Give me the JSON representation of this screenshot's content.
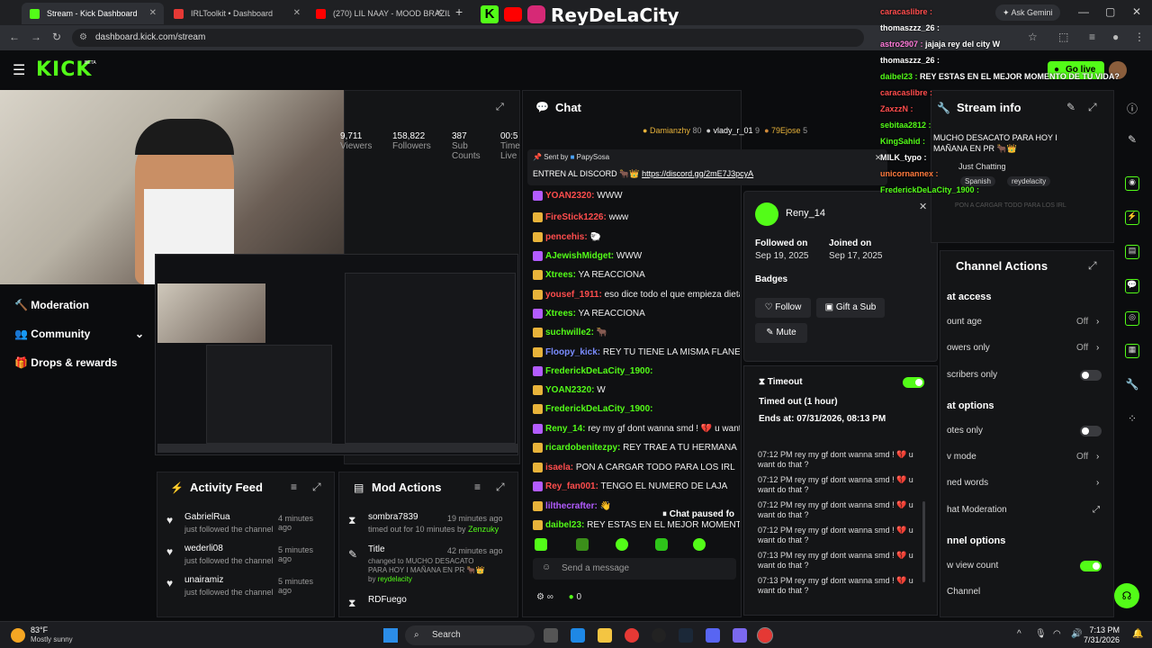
{
  "browser": {
    "tabs": [
      {
        "label": "Stream - Kick Dashboard",
        "active": true,
        "color": "#53fc18"
      },
      {
        "label": "IRLToolkit • Dashboard",
        "active": false,
        "color": "#e53935"
      },
      {
        "label": "(270) LIL NAAY - MOOD BRAZIL",
        "active": false,
        "color": "#ff0000"
      }
    ],
    "url": "dashboard.kick.com/stream",
    "ask_gemini": "Ask Gemini"
  },
  "branding": {
    "logo": "KICK",
    "logo_sup": "BETA",
    "channel_name": "ReyDeLaCity"
  },
  "sidebar": {
    "items": [
      {
        "label": "Moderation",
        "icon": "moderation-icon"
      },
      {
        "label": "Community",
        "icon": "community-icon"
      },
      {
        "label": "Drops & rewards",
        "icon": "gift-icon"
      }
    ]
  },
  "stats": [
    {
      "value": "9,711",
      "label": "Viewers"
    },
    {
      "value": "158,822",
      "label": "Followers"
    },
    {
      "value": "387",
      "label": "Sub Counts"
    },
    {
      "value": "00:5",
      "label": "Time Live"
    }
  ],
  "go_live": "Go live",
  "chat": {
    "title": "Chat",
    "top_gifters": [
      {
        "name": "Damianzhy",
        "count": "80"
      },
      {
        "name": "vlady_r_01",
        "count": "9"
      },
      {
        "name": "79Ejose",
        "count": "5"
      }
    ],
    "pinned_by_label": "Sent by",
    "pinned_by": "PapySosa",
    "pinned_text": "ENTREN AL DISCORD 🐂👑",
    "pinned_link": "https://discord.gg/2mE7J3pcyA",
    "messages": [
      {
        "user": "YOAN2320:",
        "text": "WWW",
        "color": "#ff4d4d"
      },
      {
        "user": "FireStick1226:",
        "text": "www",
        "color": "#ff4d4d"
      },
      {
        "user": "pencehis:",
        "text": "🐑",
        "color": "#ff4d4d"
      },
      {
        "user": "AJewishMidget:",
        "text": "WWW",
        "color": "#53fc18"
      },
      {
        "user": "Xtrees:",
        "text": "YA REACCIONA",
        "color": "#53fc18"
      },
      {
        "user": "yousef_1911:",
        "text": "eso dice todo el que empieza dieta",
        "color": "#ff4d4d"
      },
      {
        "user": "Xtrees:",
        "text": "YA REACCIONA",
        "color": "#53fc18"
      },
      {
        "user": "suchwille2:",
        "text": "🐂",
        "color": "#53fc18"
      },
      {
        "user": "Floopy_kick:",
        "text": "REY TU TIENE LA MISMA FLANER",
        "color": "#7a8cff"
      },
      {
        "user": "FrederickDeLaCity_1900:",
        "text": "",
        "color": "#53fc18"
      },
      {
        "user": "YOAN2320:",
        "text": "W",
        "color": "#53fc18"
      },
      {
        "user": "FrederickDeLaCity_1900:",
        "text": "",
        "color": "#53fc18"
      },
      {
        "user": "Reny_14:",
        "text": "rey my gf dont wanna smd ! 💔 u want do",
        "color": "#53fc18"
      },
      {
        "user": "ricardobenitezpy:",
        "text": "REY TRAE A TU HERMANA",
        "color": "#53fc18"
      },
      {
        "user": "isaela:",
        "text": "PON A CARGAR TODO PARA LOS IRL",
        "color": "#ff4d4d"
      },
      {
        "user": "Rey_fan001:",
        "text": "TENGO EL NUMERO DE LAJA",
        "color": "#ff4d4d"
      },
      {
        "user": "lilthecrafter:",
        "text": "👋",
        "color": "#b35cff"
      },
      {
        "user": "daibel23:",
        "text": "REY ESTAS EN EL MEJOR MOMENTO",
        "color": "#53fc18"
      }
    ],
    "paused": "Chat paused fo",
    "input_placeholder": "Send a message",
    "points": "0"
  },
  "user_card": {
    "username": "Reny_14",
    "followed_label": "Followed on",
    "followed_date": "Sep 19, 2025",
    "joined_label": "Joined on",
    "joined_date": "Sep 17, 2025",
    "badges_label": "Badges",
    "follow": "Follow",
    "gift": "Gift a Sub",
    "mute": "Mute",
    "timeout_label": "Timeout",
    "timeout_status": "Timed out (1 hour)",
    "timeout_end": "Ends at: 07/31/2026, 08:13 PM",
    "log": [
      {
        "time": "07:12 PM",
        "text": "rey my gf dont wanna smd ! 💔 u want do that ?"
      },
      {
        "time": "07:12 PM",
        "text": "rey my gf dont wanna smd ! 💔 u want do that ?"
      },
      {
        "time": "07:12 PM",
        "text": "rey my gf dont wanna smd ! 💔 u want do that ?"
      },
      {
        "time": "07:12 PM",
        "text": "rey my gf dont wanna smd ! 💔 u want do that ?"
      },
      {
        "time": "07:13 PM",
        "text": "rey my gf dont wanna smd ! 💔 u want do that ?"
      },
      {
        "time": "07:13 PM",
        "text": "rey my gf dont wanna smd ! 💔 u want do that ?"
      }
    ]
  },
  "stream_info": {
    "title": "Stream info",
    "stream_title": "MUCHO DESACATO PARA HOY I MAÑANA EN PR 🐂👑",
    "category": "Just Chatting",
    "tags": [
      "Spanish",
      "reydelacity"
    ],
    "faint": "PON A CARGAR TODO PARA LOS IRL"
  },
  "channel_actions": {
    "title": "Channel Actions",
    "rows": [
      {
        "label": "at access",
        "type": "head"
      },
      {
        "label": "ount age",
        "value": "Off",
        "type": "arrow"
      },
      {
        "label": "owers only",
        "value": "Off",
        "type": "arrow"
      },
      {
        "label": "scribers only",
        "type": "toggle-off"
      },
      {
        "label": "at options",
        "type": "head"
      },
      {
        "label": "otes only",
        "type": "toggle-off"
      },
      {
        "label": "v mode",
        "value": "Off",
        "type": "arrow"
      },
      {
        "label": "ned words",
        "type": "arrow"
      },
      {
        "label": "hat Moderation",
        "type": "ext"
      },
      {
        "label": "nnel options",
        "type": "head"
      },
      {
        "label": "w view count",
        "type": "toggle-on"
      },
      {
        "label": "Channel",
        "type": "plain"
      }
    ]
  },
  "overlay_chat": [
    {
      "user": "caracaslibre :",
      "text": "",
      "color": "#ff4d4d"
    },
    {
      "user": "thomaszzz_26 :",
      "text": "",
      "color": "#ffffff"
    },
    {
      "user": "astro2907 :",
      "text": "jajaja rey del city W",
      "color": "#ff7ad9"
    },
    {
      "user": "thomaszzz_26 :",
      "text": "",
      "color": "#ffffff"
    },
    {
      "user": "daibel23 :",
      "text": "REY ESTAS EN EL MEJOR MOMENTO DE TU VIDA?",
      "color": "#53fc18"
    },
    {
      "user": "caracaslibre :",
      "text": "",
      "color": "#ff4d4d"
    },
    {
      "user": "ZaxzzN :",
      "text": "",
      "color": "#ff4d4d"
    },
    {
      "user": "sebitaa2812 :",
      "text": "",
      "color": "#53fc18"
    },
    {
      "user": "KingSahid :",
      "text": "",
      "color": "#53fc18"
    },
    {
      "user": "MILK_typo :",
      "text": "",
      "color": "#ffffff"
    },
    {
      "user": "unicornannex :",
      "text": "",
      "color": "#ff7a3d"
    },
    {
      "user": "FrederickDeLaCity_1900 :",
      "text": "",
      "color": "#53fc18"
    }
  ],
  "activity_feed": {
    "title": "Activity Feed",
    "items": [
      {
        "user": "GabrielRua",
        "action": "just followed the channel",
        "time": "4 minutes ago"
      },
      {
        "user": "wederli08",
        "action": "just followed the channel",
        "time": "5 minutes ago"
      },
      {
        "user": "unairamiz",
        "action": "just followed the channel",
        "time": "5 minutes ago"
      }
    ]
  },
  "mod_actions": {
    "title": "Mod Actions",
    "items": [
      {
        "user": "sombra7839",
        "action": "timed out for 10 minutes by",
        "by": "Zenzuky",
        "time": "19 minutes ago"
      },
      {
        "user": "Title",
        "action": "changed to MUCHO DESACATO PARA HOY I MAÑANA EN PR 🐂👑 by",
        "by": "reydelacity",
        "time": "42 minutes ago"
      },
      {
        "user": "RDFuego",
        "action": "",
        "by": "",
        "time": "42 minutes ago"
      }
    ]
  },
  "taskbar": {
    "weather_temp": "83°F",
    "weather_desc": "Mostly sunny",
    "search": "Search",
    "time": "7:13 PM",
    "date": "7/31/2026"
  }
}
